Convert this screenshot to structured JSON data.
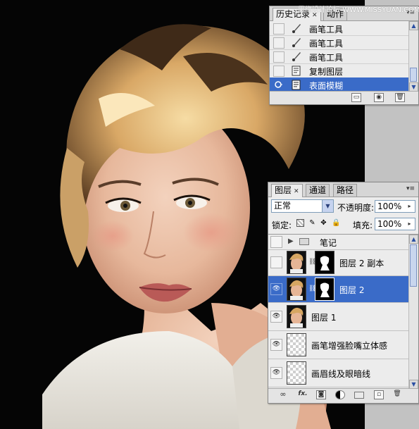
{
  "watermark": "思缘设计论坛 WWW.MISSYUAN.COM",
  "history_panel": {
    "tabs": [
      {
        "label": "历史记录",
        "active": true
      },
      {
        "label": "动作",
        "active": false
      }
    ],
    "items": [
      {
        "label": "画笔工具",
        "icon": "brush-icon",
        "selected": false
      },
      {
        "label": "画笔工具",
        "icon": "brush-icon",
        "selected": false
      },
      {
        "label": "画笔工具",
        "icon": "brush-icon",
        "selected": false
      },
      {
        "label": "复制图层",
        "icon": "history-state-icon",
        "selected": false
      },
      {
        "label": "表面模糊",
        "icon": "history-state-icon",
        "selected": true
      }
    ],
    "footer_buttons": [
      "new-document-from-state-icon",
      "camera-snapshot-icon",
      "trash-icon"
    ]
  },
  "layers_panel": {
    "tabs": [
      {
        "label": "图层",
        "active": true
      },
      {
        "label": "通道",
        "active": false
      },
      {
        "label": "路径",
        "active": false
      }
    ],
    "blend_mode": "正常",
    "opacity_label": "不透明度:",
    "opacity_value": "100%",
    "lock_label": "锁定:",
    "fill_label": "填充:",
    "fill_value": "100%",
    "lock_icons": [
      "lock-transparent-icon",
      "lock-paint-icon",
      "lock-move-icon",
      "lock-all-icon"
    ],
    "layers": [
      {
        "name": "笔记",
        "type": "group",
        "visible": false,
        "selected": false
      },
      {
        "name": "图层 2 副本",
        "type": "masked",
        "visible": false,
        "selected": false
      },
      {
        "name": "图层 2",
        "type": "masked",
        "visible": true,
        "selected": true
      },
      {
        "name": "图层 1",
        "type": "image",
        "visible": true,
        "selected": false
      },
      {
        "name": "画笔增强脸嘴立体感",
        "type": "transparent",
        "visible": true,
        "selected": false
      },
      {
        "name": "画眉线及眼暗线",
        "type": "transparent",
        "visible": true,
        "selected": false
      }
    ],
    "footer_buttons": [
      "link-icon",
      "fx-icon",
      "mask-icon",
      "adjustment-icon",
      "folder-icon",
      "new-layer-icon",
      "trash-icon"
    ],
    "fx_label": "fx."
  },
  "colors": {
    "selection": "#3a6bc8",
    "panel_bg": "#ececec"
  }
}
